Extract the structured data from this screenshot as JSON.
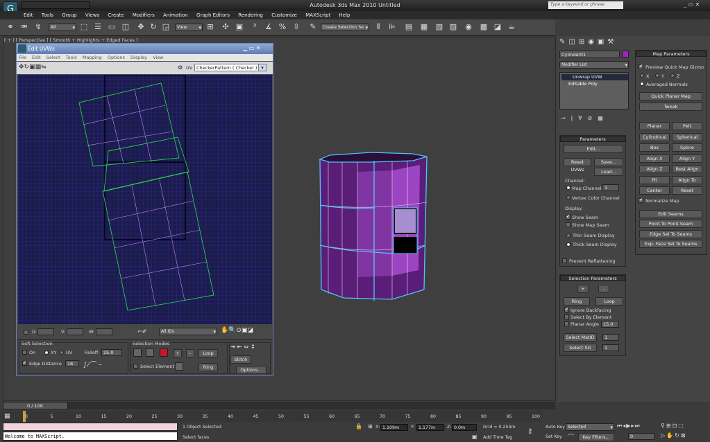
{
  "window": {
    "title": "Autodesk 3ds Max  2010       Untitled",
    "search_placeholder": "Type a keyword or phrase"
  },
  "menu": [
    "Edit",
    "Tools",
    "Group",
    "Views",
    "Create",
    "Modifiers",
    "Animation",
    "Graph Editors",
    "Rendering",
    "Customize",
    "MAXScript",
    "Help"
  ],
  "toolbar": {
    "filter": "All",
    "coord": "View",
    "named_sel": "Create Selection Se"
  },
  "viewport": {
    "label": "[ + ] [ Perspective ] [ Smooth + Highlights + Edged Faces ]"
  },
  "uvw": {
    "title": "Edit UVWs",
    "menu": [
      "File",
      "Edit",
      "Select",
      "Tools",
      "Mapping",
      "Options",
      "Display",
      "View"
    ],
    "uv_label": "UV",
    "texture": "CheckerPattern  ( Checker )",
    "u_label": "U:",
    "v_label": "V:",
    "w_label": "W:",
    "ids": "All IDs",
    "soft": {
      "title": "Soft Selection",
      "on": "On",
      "xy": "XY",
      "uv": "UV",
      "falloff_label": "Falloff:",
      "falloff": "25.0",
      "edge_distance": "Edge Distance",
      "edge_val": "16"
    },
    "selmodes": {
      "title": "Selection Modes",
      "loop": "Loop",
      "ring": "Ring",
      "select_element": "Select Element",
      "stitch": "Stitch",
      "options": "Options..."
    }
  },
  "cmd": {
    "object_name": "Cylinder01",
    "modifier_list": "Modifier List",
    "stack": [
      "Unwrap UVW",
      "Editable Poly"
    ],
    "parameters": {
      "title": "Parameters",
      "edit": "Edit...",
      "reset": "Reset UVWs",
      "save": "Save...",
      "load": "Load...",
      "channel": "Channel:",
      "map_channel": "Map Channel:",
      "map_channel_val": "1",
      "vertex_color": "Vertex Color Channel",
      "display": "Display:",
      "show_seam": "Show Seam",
      "show_map_seam": "Show Map Seam",
      "thin": "Thin Seam Display",
      "thick": "Thick Seam Display",
      "prevent": "Prevent Reflattening"
    },
    "selparams": {
      "title": "Selection Parameters",
      "plus": "+",
      "minus": "-",
      "ring": "Ring",
      "loop": "Loop",
      "ignore": "Ignore Backfacing",
      "by_element": "Select By Element",
      "planar": "Planar Angle",
      "planar_val": "15.0",
      "matid": "Select MatID",
      "matid_val": "1",
      "sg": "Select SG",
      "sg_val": "1"
    },
    "mapparams": {
      "title": "Map Parameters",
      "preview": "Preview Quick Map Gizmo",
      "x": "X",
      "y": "Y",
      "z": "Z",
      "averaged": "Averaged Normals",
      "quick": "Quick Planar Map",
      "tweak": "Tweak",
      "buttons": [
        [
          "Planar",
          "Pelt"
        ],
        [
          "Cylindrical",
          "Spherical"
        ],
        [
          "Box",
          "Spline"
        ],
        [
          "Align X",
          "Align Y"
        ],
        [
          "Align Z",
          "Best Align"
        ],
        [
          "Fit",
          "Align To View"
        ],
        [
          "Center",
          "Reset"
        ]
      ],
      "normalize": "Normalize Map",
      "seams": [
        "Edit Seams",
        "Point To Point Seam",
        "Edge Sel To Seams",
        "Exp. Face Sel To Seams"
      ]
    }
  },
  "timeline": {
    "frame": "0 / 100",
    "ticks": [
      "0",
      "5",
      "10",
      "15",
      "20",
      "25",
      "30",
      "35",
      "40",
      "45",
      "50",
      "55",
      "60",
      "65",
      "70",
      "75",
      "80",
      "85",
      "90",
      "95",
      "100"
    ]
  },
  "status": {
    "selected": "1 Object Selected",
    "prompt": "Select faces",
    "maxscript": "Welcome to MAXScript.",
    "x_label": "X:",
    "x": "1.109m",
    "y_label": "Y:",
    "y": "1.177m",
    "z_label": "Z:",
    "z": "0.0m",
    "grid": "Grid = 0.254m",
    "autokey": "Auto Key",
    "setkey": "Set Key",
    "selected_drop": "Selected",
    "keyfilters": "Key Filters...",
    "addtime": "Add Time Tag",
    "frame_spin": "0"
  }
}
